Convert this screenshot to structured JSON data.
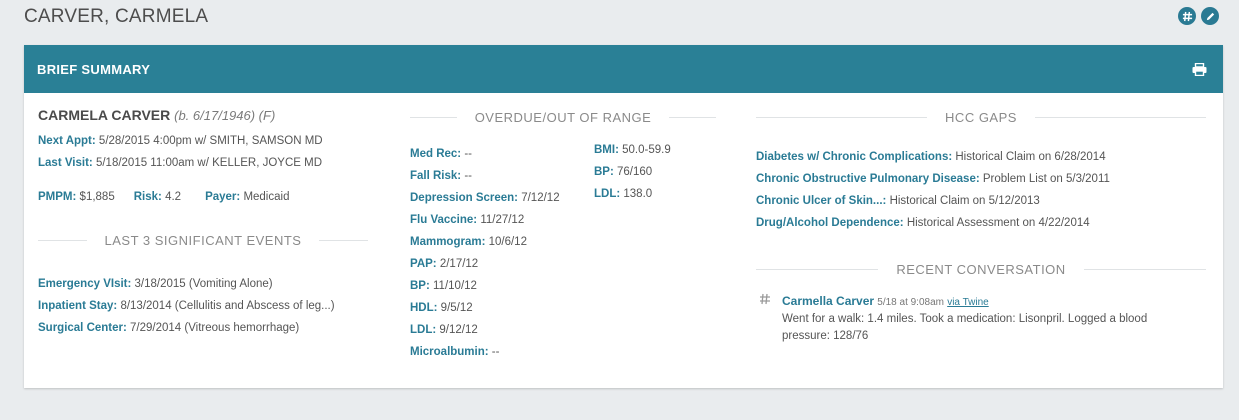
{
  "page": {
    "title": "CARVER, CARMELA",
    "icons": [
      "hash-icon",
      "edit-icon"
    ]
  },
  "card": {
    "title": "BRIEF SUMMARY",
    "print_icon": "print-icon"
  },
  "patient": {
    "name": "CARMELA CARVER",
    "meta": "(b. 6/17/1946) (F)",
    "next_appt": {
      "label": "Next Appt:",
      "value": "5/28/2015 4:00pm w/ SMITH, SAMSON MD"
    },
    "last_visit": {
      "label": "Last Visit:",
      "value": "5/18/2015 11:00am w/ KELLER, JOYCE MD"
    },
    "pmpm": {
      "label": "PMPM:",
      "value": "$1,885"
    },
    "risk": {
      "label": "Risk:",
      "value": "4.2"
    },
    "payer": {
      "label": "Payer:",
      "value": "Medicaid"
    }
  },
  "events": {
    "title": "LAST 3 SIGNIFICANT EVENTS",
    "items": [
      {
        "label": "Emergency VIsit:",
        "value": "3/18/2015 (Vomiting Alone)"
      },
      {
        "label": "Inpatient Stay:",
        "value": "8/13/2014 (Cellulitis and Abscess of leg...)"
      },
      {
        "label": "Surgical Center:",
        "value": "7/29/2014 (Vitreous hemorrhage)"
      }
    ]
  },
  "overdue": {
    "title": "OVERDUE/OUT OF RANGE",
    "left": [
      {
        "label": "Med Rec:",
        "value": "--"
      },
      {
        "label": "Fall Risk:",
        "value": "--"
      },
      {
        "label": "Depression Screen:",
        "value": "7/12/12"
      },
      {
        "label": "Flu Vaccine:",
        "value": "11/27/12"
      },
      {
        "label": "Mammogram:",
        "value": "10/6/12"
      },
      {
        "label": "PAP:",
        "value": "2/17/12"
      },
      {
        "label": "BP:",
        "value": "11/10/12"
      },
      {
        "label": "HDL:",
        "value": "9/5/12"
      },
      {
        "label": "LDL:",
        "value": "9/12/12"
      },
      {
        "label": "Microalbumin:",
        "value": "--"
      }
    ],
    "right": [
      {
        "label": "BMI:",
        "value": "50.0-59.9"
      },
      {
        "label": "BP:",
        "value": "76/160"
      },
      {
        "label": "LDL:",
        "value": "138.0"
      }
    ]
  },
  "hcc": {
    "title": "HCC GAPS",
    "items": [
      {
        "label": "Diabetes w/ Chronic Complications:",
        "value": "Historical Claim on 6/28/2014"
      },
      {
        "label": "Chronic Obstructive Pulmonary Disease:",
        "value": "Problem List on 5/3/2011"
      },
      {
        "label": "Chronic Ulcer of Skin...:",
        "value": "Historical Claim on 5/12/2013"
      },
      {
        "label": "Drug/Alcohol Dependence:",
        "value": "Historical Assessment on 4/22/2014"
      }
    ]
  },
  "conversation": {
    "title": "RECENT CONVERSATION",
    "who": "Carmella Carver",
    "time": "5/18 at 9:08am",
    "via": "via Twine",
    "message": "Went for a walk: 1.4 miles. Took a medication: Lisonpril. Logged a blood pressure: 128/76"
  },
  "colors": {
    "header": "#2a8096",
    "label": "#2a7b95",
    "background": "#e9ecee"
  }
}
